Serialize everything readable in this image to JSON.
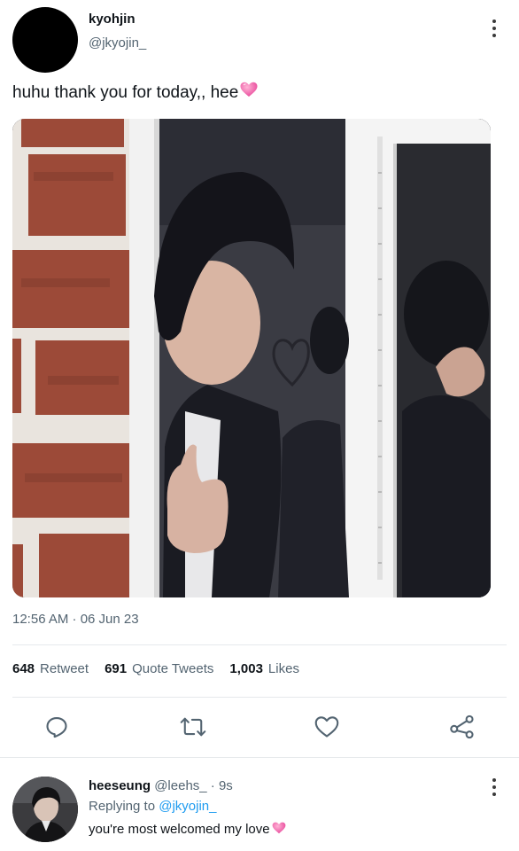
{
  "tweet": {
    "author_name": "kyohjin",
    "author_handle": "@jkyojin_",
    "text": "huhu thank you for today,, hee",
    "text_emoji": "pink-heart-icon",
    "timestamp": "12:56 AM · 06 Jun 23",
    "media_alt": "photo"
  },
  "stats": {
    "retweets_count": "648",
    "retweets_label": "Retweet",
    "quotes_count": "691",
    "quotes_label": "Quote Tweets",
    "likes_count": "1,003",
    "likes_label": "Likes"
  },
  "actions": [
    "reply-icon",
    "retweet-icon",
    "like-icon",
    "share-icon"
  ],
  "reply": {
    "author_name": "heeseung",
    "author_meta": "@leehs_ · 9s",
    "replying_prefix": "Replying to",
    "replying_to": "@jkyojin_",
    "text": "you're most welcomed my love",
    "text_emoji": "pink-heart-icon"
  },
  "colors": {
    "text": "#0f1419",
    "secondary": "#536471",
    "link": "#1d9bf0",
    "heart": "#f06aa8"
  }
}
